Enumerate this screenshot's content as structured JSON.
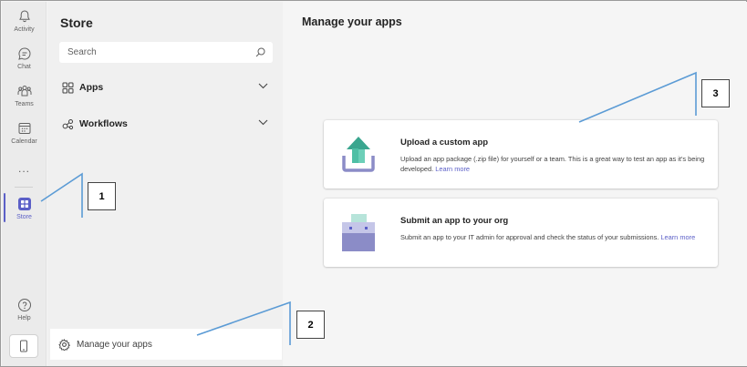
{
  "app_bar": {
    "items": [
      {
        "label": "Activity",
        "icon": "bell-icon"
      },
      {
        "label": "Chat",
        "icon": "chat-icon"
      },
      {
        "label": "Teams",
        "icon": "teams-icon"
      },
      {
        "label": "Calendar",
        "icon": "calendar-icon"
      },
      {
        "label": "Store",
        "icon": "store-icon",
        "active": true
      },
      {
        "label": "Help",
        "icon": "help-icon"
      }
    ],
    "more": "...",
    "accent_color": "#5b5fc7"
  },
  "store_panel": {
    "title": "Store",
    "search_placeholder": "Search",
    "nav": [
      {
        "label": "Apps",
        "icon": "apps-icon"
      },
      {
        "label": "Workflows",
        "icon": "workflows-icon"
      }
    ],
    "manage_label": "Manage your apps"
  },
  "main": {
    "title": "Manage your apps",
    "cards": [
      {
        "title": "Upload a custom app",
        "description": "Upload an app package (.zip file) for yourself or a team. This is a great way to test an app as it's being developed.",
        "link": "Learn more",
        "icon": "upload-icon"
      },
      {
        "title": "Submit an app to your org",
        "description": "Submit an app to your IT admin for approval and check the status of your submissions.",
        "link": "Learn more",
        "icon": "submit-icon"
      }
    ]
  },
  "callouts": [
    "1",
    "2",
    "3"
  ],
  "callout_line_color": "#5b9bd5"
}
